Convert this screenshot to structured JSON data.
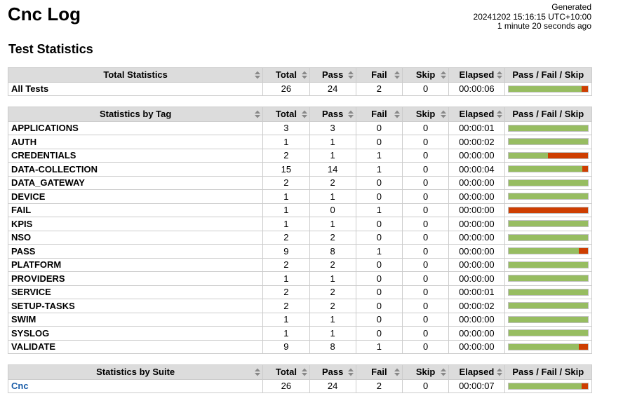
{
  "title": "Cnc Log",
  "generated": {
    "label": "Generated",
    "timestamp": "20241202 15:16:15 UTC+10:00",
    "ago": "1 minute 20 seconds ago"
  },
  "section_title": "Test Statistics",
  "columns": [
    "Total",
    "Pass",
    "Fail",
    "Skip",
    "Elapsed",
    "Pass / Fail / Skip"
  ],
  "colors": {
    "pass": "#97bd61",
    "fail": "#ce3e01",
    "skip": "#fed84f",
    "header": "#dcdcdc",
    "link": "#1a5da8"
  },
  "total_table": {
    "header": "Total Statistics",
    "rows": [
      {
        "name": "All Tests",
        "total": "26",
        "pass": "24",
        "fail": "2",
        "skip": "0",
        "elapsed": "00:00:06"
      }
    ]
  },
  "tag_table": {
    "header": "Statistics by Tag",
    "rows": [
      {
        "name": "APPLICATIONS",
        "total": "3",
        "pass": "3",
        "fail": "0",
        "skip": "0",
        "elapsed": "00:00:01"
      },
      {
        "name": "AUTH",
        "total": "1",
        "pass": "1",
        "fail": "0",
        "skip": "0",
        "elapsed": "00:00:02"
      },
      {
        "name": "CREDENTIALS",
        "total": "2",
        "pass": "1",
        "fail": "1",
        "skip": "0",
        "elapsed": "00:00:00"
      },
      {
        "name": "DATA-COLLECTION",
        "total": "15",
        "pass": "14",
        "fail": "1",
        "skip": "0",
        "elapsed": "00:00:04"
      },
      {
        "name": "DATA_GATEWAY",
        "total": "2",
        "pass": "2",
        "fail": "0",
        "skip": "0",
        "elapsed": "00:00:00"
      },
      {
        "name": "DEVICE",
        "total": "1",
        "pass": "1",
        "fail": "0",
        "skip": "0",
        "elapsed": "00:00:00"
      },
      {
        "name": "FAIL",
        "total": "1",
        "pass": "0",
        "fail": "1",
        "skip": "0",
        "elapsed": "00:00:00"
      },
      {
        "name": "KPIS",
        "total": "1",
        "pass": "1",
        "fail": "0",
        "skip": "0",
        "elapsed": "00:00:00"
      },
      {
        "name": "NSO",
        "total": "2",
        "pass": "2",
        "fail": "0",
        "skip": "0",
        "elapsed": "00:00:00"
      },
      {
        "name": "PASS",
        "total": "9",
        "pass": "8",
        "fail": "1",
        "skip": "0",
        "elapsed": "00:00:00"
      },
      {
        "name": "PLATFORM",
        "total": "2",
        "pass": "2",
        "fail": "0",
        "skip": "0",
        "elapsed": "00:00:00"
      },
      {
        "name": "PROVIDERS",
        "total": "1",
        "pass": "1",
        "fail": "0",
        "skip": "0",
        "elapsed": "00:00:00"
      },
      {
        "name": "SERVICE",
        "total": "2",
        "pass": "2",
        "fail": "0",
        "skip": "0",
        "elapsed": "00:00:01"
      },
      {
        "name": "SETUP-TASKS",
        "total": "2",
        "pass": "2",
        "fail": "0",
        "skip": "0",
        "elapsed": "00:00:02"
      },
      {
        "name": "SWIM",
        "total": "1",
        "pass": "1",
        "fail": "0",
        "skip": "0",
        "elapsed": "00:00:00"
      },
      {
        "name": "SYSLOG",
        "total": "1",
        "pass": "1",
        "fail": "0",
        "skip": "0",
        "elapsed": "00:00:00"
      },
      {
        "name": "VALIDATE",
        "total": "9",
        "pass": "8",
        "fail": "1",
        "skip": "0",
        "elapsed": "00:00:00"
      }
    ]
  },
  "suite_table": {
    "header": "Statistics by Suite",
    "rows": [
      {
        "name": "Cnc",
        "total": "26",
        "pass": "24",
        "fail": "2",
        "skip": "0",
        "elapsed": "00:00:07",
        "link": true
      }
    ]
  }
}
